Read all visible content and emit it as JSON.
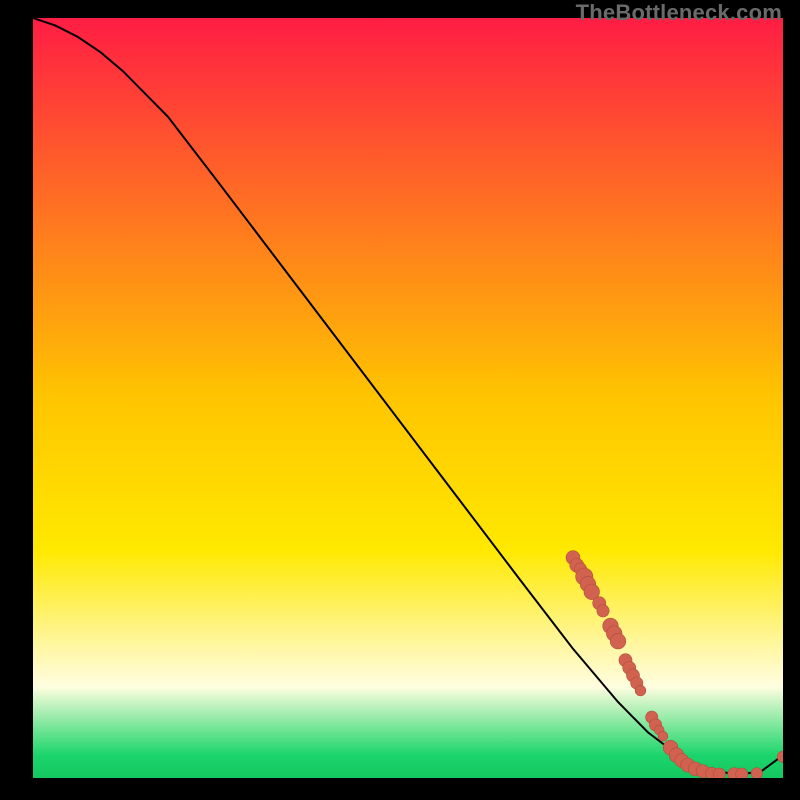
{
  "watermark": "TheBottleneck.com",
  "colors": {
    "background": "#000000",
    "gradient_stops": [
      {
        "offset": 0.0,
        "color": "#ff1d44"
      },
      {
        "offset": 0.5,
        "color": "#ffc500"
      },
      {
        "offset": 0.7,
        "color": "#ffe900"
      },
      {
        "offset": 0.82,
        "color": "#fff69a"
      },
      {
        "offset": 0.88,
        "color": "#fffde0"
      },
      {
        "offset": 0.94,
        "color": "#66e38f"
      },
      {
        "offset": 0.97,
        "color": "#1bd56c"
      },
      {
        "offset": 1.0,
        "color": "#14c85f"
      }
    ],
    "curve": "#000000",
    "point_fill": "#d1624f",
    "point_stroke": "#b24c3c"
  },
  "chart_data": {
    "type": "line",
    "title": "",
    "xlabel": "",
    "ylabel": "",
    "xlim": [
      0,
      100
    ],
    "ylim": [
      0,
      100
    ],
    "series": [
      {
        "name": "curve",
        "x": [
          0,
          3,
          6,
          9,
          12,
          18,
          25,
          35,
          45,
          55,
          65,
          72,
          78,
          82,
          86,
          90,
          94,
          97,
          100
        ],
        "y": [
          100,
          99,
          97.5,
          95.5,
          93,
          87,
          78,
          65,
          52,
          39,
          26,
          17,
          10,
          6,
          3,
          1,
          0.5,
          0.8,
          3
        ]
      }
    ],
    "points": [
      {
        "x": 72.0,
        "y": 29.0,
        "r": 1.2
      },
      {
        "x": 72.5,
        "y": 28.0,
        "r": 1.2
      },
      {
        "x": 73.0,
        "y": 27.5,
        "r": 1.0
      },
      {
        "x": 73.5,
        "y": 26.5,
        "r": 1.6
      },
      {
        "x": 74.0,
        "y": 25.5,
        "r": 1.4
      },
      {
        "x": 74.5,
        "y": 24.5,
        "r": 1.4
      },
      {
        "x": 75.5,
        "y": 23.0,
        "r": 1.1
      },
      {
        "x": 76.0,
        "y": 22.0,
        "r": 1.0
      },
      {
        "x": 77.0,
        "y": 20.0,
        "r": 1.4
      },
      {
        "x": 77.5,
        "y": 19.0,
        "r": 1.4
      },
      {
        "x": 78.0,
        "y": 18.0,
        "r": 1.4
      },
      {
        "x": 79.0,
        "y": 15.5,
        "r": 1.1
      },
      {
        "x": 79.5,
        "y": 14.5,
        "r": 1.1
      },
      {
        "x": 80.0,
        "y": 13.5,
        "r": 1.1
      },
      {
        "x": 80.5,
        "y": 12.5,
        "r": 1.0
      },
      {
        "x": 81.0,
        "y": 11.5,
        "r": 0.8
      },
      {
        "x": 82.5,
        "y": 8.0,
        "r": 1.0
      },
      {
        "x": 83.0,
        "y": 7.0,
        "r": 1.0
      },
      {
        "x": 83.5,
        "y": 6.3,
        "r": 0.7
      },
      {
        "x": 84.0,
        "y": 5.5,
        "r": 0.7
      },
      {
        "x": 85.0,
        "y": 4.0,
        "r": 1.3
      },
      {
        "x": 85.8,
        "y": 3.0,
        "r": 1.3
      },
      {
        "x": 86.5,
        "y": 2.3,
        "r": 1.2
      },
      {
        "x": 87.3,
        "y": 1.7,
        "r": 1.2
      },
      {
        "x": 88.3,
        "y": 1.2,
        "r": 1.2
      },
      {
        "x": 89.3,
        "y": 0.9,
        "r": 1.1
      },
      {
        "x": 90.5,
        "y": 0.6,
        "r": 1.0
      },
      {
        "x": 91.5,
        "y": 0.5,
        "r": 1.0
      },
      {
        "x": 93.5,
        "y": 0.5,
        "r": 1.1
      },
      {
        "x": 94.5,
        "y": 0.5,
        "r": 1.0
      },
      {
        "x": 96.5,
        "y": 0.6,
        "r": 0.9
      },
      {
        "x": 100.0,
        "y": 2.8,
        "r": 0.9
      }
    ]
  }
}
